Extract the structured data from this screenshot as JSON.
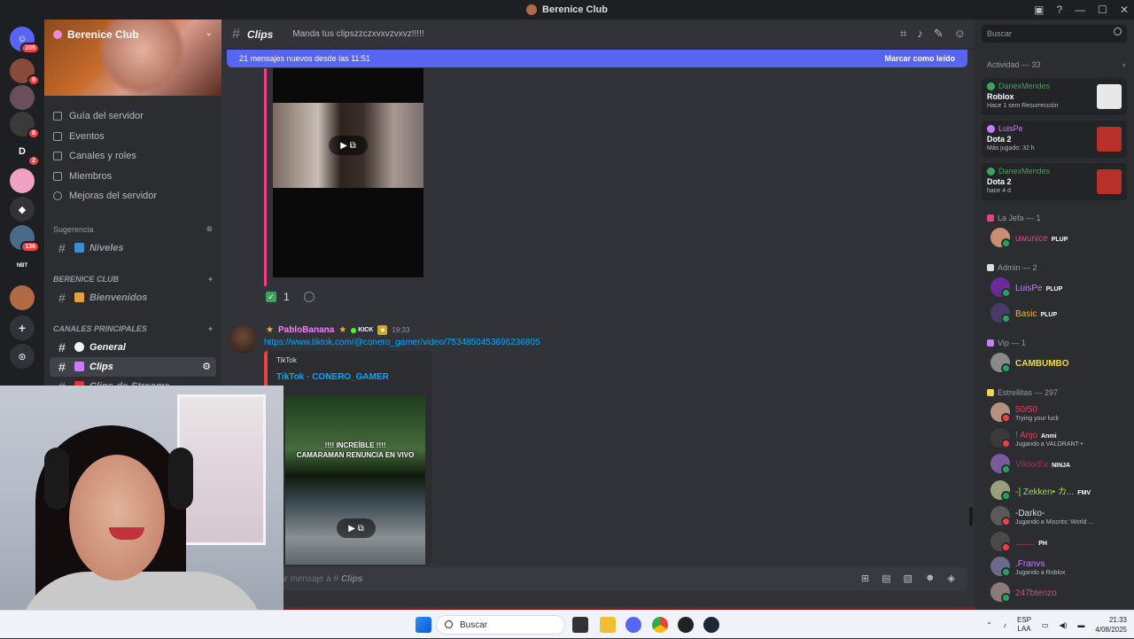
{
  "window": {
    "title": "Berenice Club",
    "time_clock": "21:33",
    "date": "4/08/2025"
  },
  "guilds": [
    {
      "name": "discord-home",
      "label": "",
      "badge": "205",
      "color": "#5865f2"
    },
    {
      "name": "guild-1",
      "label": "",
      "badge": "9",
      "color": "#8a4a3a"
    },
    {
      "name": "guild-2",
      "label": "",
      "badge": "",
      "color": "#6a4e5a"
    },
    {
      "name": "guild-3",
      "label": "",
      "badge": "8",
      "color": "#3a3a3a"
    },
    {
      "name": "guild-d",
      "label": "D",
      "badge": "2",
      "color": "#1e1f22"
    },
    {
      "name": "guild-kitty",
      "label": "",
      "badge": "",
      "color": "#f0a0c0"
    },
    {
      "name": "guild-6",
      "label": "",
      "badge": "",
      "color": "#313338"
    },
    {
      "name": "guild-7",
      "label": "",
      "badge": "136",
      "color": "#4a6a8a"
    },
    {
      "name": "guild-nbt",
      "label": "NBT",
      "badge": "",
      "color": "#1e1f22"
    },
    {
      "name": "guild-berenice",
      "label": "",
      "badge": "",
      "color": "#b06a45"
    }
  ],
  "sidebar": {
    "server_name": "Berenice Club",
    "nav": [
      "Guía del servidor",
      "Eventos",
      "Canales y roles",
      "Miembros",
      "Mejoras del servidor"
    ],
    "cat_sugerencia": "Sugerencia",
    "ch_niveles": "Niveles",
    "cat_berenice": "BERENICE CLUB",
    "ch_bienvenidos": "Bienvenidos",
    "cat_canales": "CANALES PRINCIPALES",
    "ch_general": "General",
    "ch_clips": "Clips",
    "ch_clips_streams": "Clips-de-Streams"
  },
  "header": {
    "channel": "Clips",
    "topic": "Manda tus clipszzczxvxvzvxvz!!!!!"
  },
  "newbar": {
    "text": "21 mensajes nuevos desde las 11:51",
    "action": "Marcar como leído"
  },
  "messages": {
    "reaction_count": "1",
    "author": "PabloBanana",
    "badge": "KICK",
    "time": "19:33",
    "link": "https://www.tiktok.com/@conero_gamer/video/7534850453696236805",
    "embed_provider": "TikTok",
    "embed_title": "TikTok · CONERO_GAMER",
    "thumb_caption_1": "!!!! INCREÍBLE !!!!",
    "thumb_caption_2": "CAMARAMAN RENUNCIA EN VIVO"
  },
  "composer": {
    "prefix": "ar mensaje a #",
    "channel": "Clips"
  },
  "right": {
    "search_placeholder": "Buscar",
    "activity_header": "Actividad — 33",
    "activities": [
      {
        "user": "DanexMendes",
        "game": "Roblox",
        "detail": "Hace 1 sem   Resurrección",
        "color": "#3ba55d",
        "art": "#e8e8e8"
      },
      {
        "user": "LuisPe",
        "game": "Dota 2",
        "detail": "Más jugado: 32 h",
        "color": "#c77dff",
        "art": "#b8302a"
      },
      {
        "user": "DanexMendes",
        "game": "Dota 2",
        "detail": "hace 4 d",
        "color": "#3ba55d",
        "art": "#b8302a"
      }
    ],
    "role_jefa": "La Jefa — 1",
    "role_admin": "Admin — 2",
    "role_vip": "Vip — 1",
    "role_estrellitas": "Estrellitas — 297",
    "members": [
      {
        "name": "uwunice",
        "tag": "PLUP",
        "status": "",
        "color": "#e0458a"
      },
      {
        "name": "LuisPe",
        "tag": "PLUP",
        "status": "",
        "color": "#c77dff"
      },
      {
        "name": "Basic",
        "tag": "PLUP",
        "status": "",
        "color": "#f0b232"
      },
      {
        "name": "CAMBUMBO",
        "tag": "",
        "status": "",
        "color": "#f0d84a"
      },
      {
        "name": "50/50",
        "tag": "",
        "status": "Trying your luck",
        "color": "#e04060"
      },
      {
        "name": "! Anjo",
        "tag": "Anmi",
        "status": "Jugando a VALORANT •",
        "color": "#e04060"
      },
      {
        "name": "ViktorEx",
        "tag": "NINJA",
        "status": "",
        "color": "#a23050"
      },
      {
        "name": "-] Zekken• カ...",
        "tag": "FMV",
        "status": "",
        "color": "#a8d84a"
      },
      {
        "name": "-Darko-",
        "tag": "",
        "status": "Jugando a Miscrits: World ...",
        "color": "#dbdee1"
      },
      {
        "name": "........",
        "tag": "PH",
        "status": "",
        "color": "#e04060"
      },
      {
        "name": ".Franvs",
        "tag": "",
        "status": "Jugando a Roblox",
        "color": "#c77dff"
      },
      {
        "name": "247btenzo",
        "tag": "",
        "status": "",
        "color": "#e0458a"
      }
    ]
  },
  "taskbar": {
    "search": "Buscar",
    "lang_1": "ESP",
    "lang_2": "LAA"
  }
}
